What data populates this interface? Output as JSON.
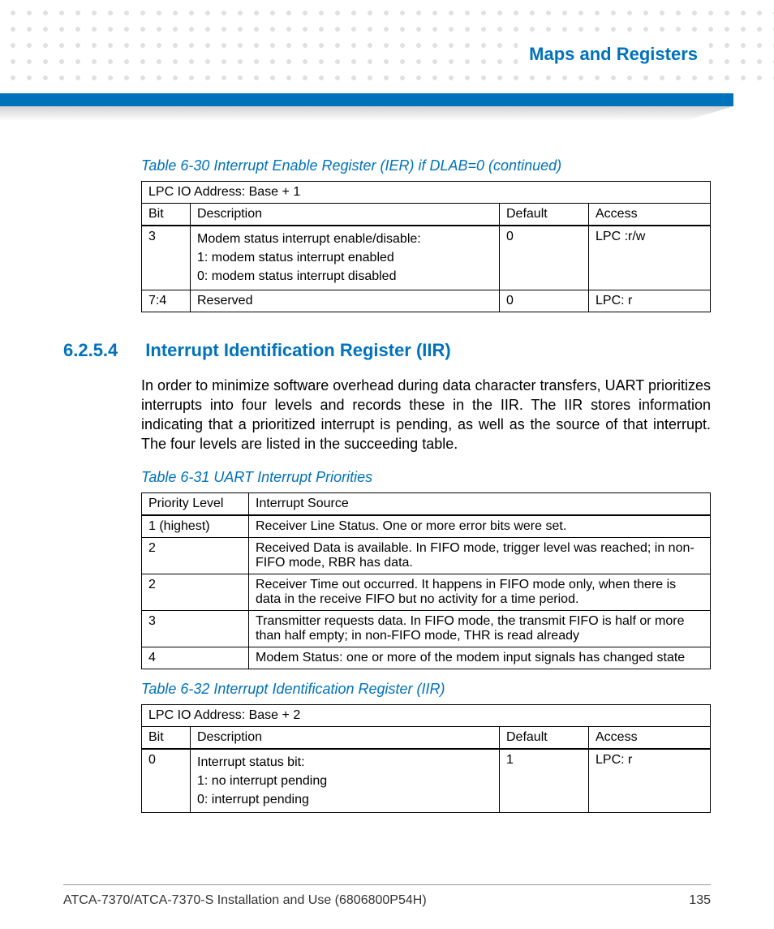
{
  "header": {
    "chapter_title": "Maps and Registers"
  },
  "table30": {
    "caption": "Table 6-30 Interrupt Enable Register (IER) if DLAB=0 (continued)",
    "addr": "LPC IO Address: Base + 1",
    "hdr_bit": "Bit",
    "hdr_desc": "Description",
    "hdr_def": "Default",
    "hdr_acc": "Access",
    "r1_bit": "3",
    "r1_desc_l1": "Modem status interrupt enable/disable:",
    "r1_desc_l2": "1: modem status interrupt enabled",
    "r1_desc_l3": "0: modem status interrupt disabled",
    "r1_def": "0",
    "r1_acc": "LPC :r/w",
    "r2_bit": "7:4",
    "r2_desc": "Reserved",
    "r2_def": "0",
    "r2_acc": "LPC: r"
  },
  "section": {
    "num": "6.2.5.4",
    "title": "Interrupt Identification Register (IIR)",
    "para": "In order to minimize software overhead during data character transfers, UART prioritizes interrupts into four levels and records these in the IIR. The IIR stores information indicating that a prioritized interrupt is pending, as well as the source of that interrupt. The four levels are listed in the succeeding table."
  },
  "table31": {
    "caption": "Table 6-31 UART Interrupt Priorities",
    "hdr_a": "Priority Level",
    "hdr_b": "Interrupt Source",
    "r1_a": "1 (highest)",
    "r1_b": "Receiver Line Status. One or more error bits were set.",
    "r2_a": "2",
    "r2_b": "Received Data is available. In FIFO mode, trigger level was reached; in non-FIFO mode, RBR has data.",
    "r3_a": "2",
    "r3_b": "Receiver Time out occurred. It happens in FIFO mode only, when there is data in the receive FIFO but no activity for a time period.",
    "r4_a": "3",
    "r4_b": "Transmitter requests data. In FIFO mode, the transmit FIFO is half or more than half empty; in non-FIFO mode, THR is read already",
    "r5_a": "4",
    "r5_b": "Modem Status: one or more of the modem input signals has changed state"
  },
  "table32": {
    "caption": "Table 6-32 Interrupt Identification Register (IIR)",
    "addr": "LPC IO Address: Base + 2",
    "hdr_bit": "Bit",
    "hdr_desc": "Description",
    "hdr_def": "Default",
    "hdr_acc": "Access",
    "r1_bit": "0",
    "r1_desc_l1": "Interrupt status bit:",
    "r1_desc_l2": "1: no interrupt pending",
    "r1_desc_l3": "0: interrupt pending",
    "r1_def": "1",
    "r1_acc": "LPC: r"
  },
  "footer": {
    "doc": "ATCA-7370/ATCA-7370-S Installation and Use (6806800P54H)",
    "page": "135"
  }
}
